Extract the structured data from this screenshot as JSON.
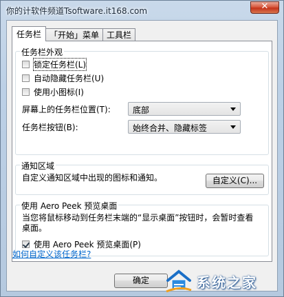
{
  "window": {
    "title": "你的计软件频道Tsoftware.it168.com",
    "close_glyph": "✕"
  },
  "tabs": [
    {
      "label": "任务栏"
    },
    {
      "label": "「开始」菜单"
    },
    {
      "label": "工具栏"
    }
  ],
  "appearance": {
    "group_label": "任务栏外观",
    "lock_taskbar": {
      "label": "锁定任务栏(L)",
      "checked": false
    },
    "auto_hide": {
      "label": "自动隐藏任务栏(U)",
      "checked": false
    },
    "small_icons": {
      "label": "使用小图标(I)",
      "checked": false
    },
    "position_label": "屏幕上的任务栏位置(T):",
    "position_value": "底部",
    "buttons_label": "任务栏按钮(B):",
    "buttons_value": "始终合并、隐藏标签"
  },
  "notify": {
    "group_label": "通知区域",
    "description": "自定义通知区域中出现的图标和通知。",
    "customize_button": "自定义(C)..."
  },
  "peek": {
    "group_label": "使用 Aero Peek 预览桌面",
    "description": "当您将鼠标移动到任务栏末端的“显示桌面”按钮时，会暂时查看桌面。",
    "checkbox": {
      "label": "使用 Aero Peek 预览桌面(P)",
      "checked": true
    }
  },
  "help_link": "如何自定义该任务栏?",
  "footer": {
    "ok_button": "确定"
  },
  "watermark": {
    "text": "系统之家",
    "logo_icon": "house-logo-icon"
  },
  "colors": {
    "link": "#0066cc",
    "close": "#c4341c"
  }
}
